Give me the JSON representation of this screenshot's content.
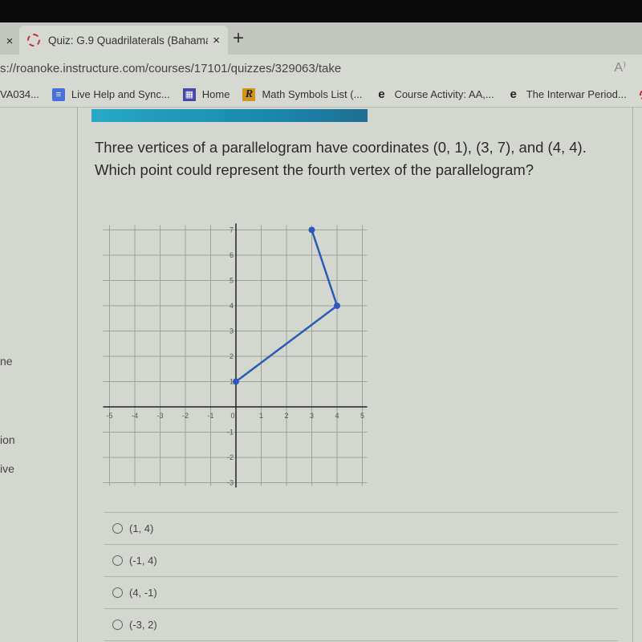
{
  "browser": {
    "prev_tab_close": "×",
    "active_tab": {
      "title": "Quiz: G.9 Quadrilaterals (Bahama",
      "close": "×",
      "favicon": "canvas-ring-icon"
    },
    "new_tab": "+",
    "url": "s://roanoke.instructure.com/courses/17101/quizzes/329063/take",
    "read_aloud": "A⁾",
    "bookmarks": [
      {
        "label": "VA034...",
        "icon": "none"
      },
      {
        "label": "Live Help and Sync...",
        "icon": "doc-icon"
      },
      {
        "label": "Home",
        "icon": "home-icon"
      },
      {
        "label": "Math Symbols List (...",
        "icon": "r-icon"
      },
      {
        "label": "Course Activity: AA,...",
        "icon": "edge-icon"
      },
      {
        "label": "The Interwar Period...",
        "icon": "edge-icon"
      }
    ]
  },
  "left_nav": {
    "items": [
      "ne",
      "ion",
      "ive"
    ]
  },
  "question": {
    "line1": "Three vertices of a parallelogram have coordinates (0, 1), (3, 7), and (4, 4).",
    "line2": "Which point could represent the fourth vertex of the parallelogram?"
  },
  "graph": {
    "x_range": [
      -5,
      5
    ],
    "y_range": [
      -3,
      7
    ],
    "x_ticks": [
      "-5",
      "-4",
      "-3",
      "-2",
      "-1",
      "0",
      "1",
      "2",
      "3",
      "4",
      "5"
    ],
    "y_ticks": [
      "7",
      "6",
      "5",
      "4",
      "3",
      "2",
      "1",
      "-1",
      "-2",
      "-3"
    ],
    "points": [
      {
        "x": 3,
        "y": 7
      },
      {
        "x": 4,
        "y": 4
      },
      {
        "x": 0,
        "y": 1
      }
    ],
    "line_color": "#2b5bb8"
  },
  "options": [
    {
      "label": "(1, 4)"
    },
    {
      "label": "(-1, 4)"
    },
    {
      "label": "(4, -1)"
    },
    {
      "label": "(-3, 2)"
    }
  ]
}
